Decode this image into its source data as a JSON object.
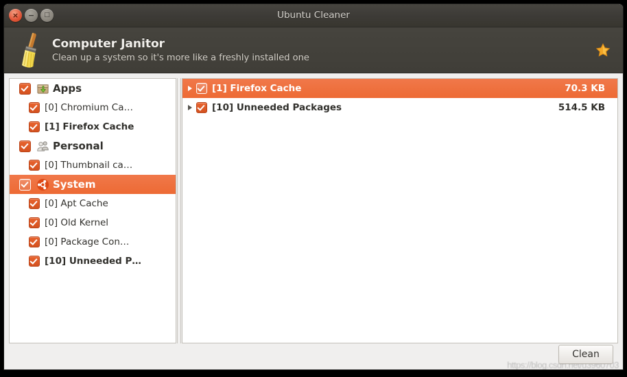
{
  "window": {
    "title": "Ubuntu Cleaner",
    "controls": [
      {
        "name": "close",
        "glyph": "×"
      },
      {
        "name": "minimize",
        "glyph": "−"
      },
      {
        "name": "maximize",
        "glyph": "□"
      }
    ]
  },
  "header": {
    "icon": "broom-icon",
    "title": "Computer Janitor",
    "subtitle": "Clean up a system so it's more like a freshly installed one",
    "favorite_icon": "star-icon"
  },
  "sidebar": {
    "items": [
      {
        "label": "Apps",
        "checked": true,
        "level": 0,
        "icon": "package-icon",
        "bold": true,
        "selected": false,
        "truncated": false
      },
      {
        "label": "[0] Chromium Ca…",
        "checked": true,
        "level": 1,
        "icon": "",
        "bold": false,
        "selected": false,
        "truncated": true
      },
      {
        "label": "[1] Firefox Cache",
        "checked": true,
        "level": 1,
        "icon": "",
        "bold": true,
        "selected": false,
        "truncated": false
      },
      {
        "label": "Personal",
        "checked": true,
        "level": 0,
        "icon": "people-icon",
        "bold": true,
        "selected": false,
        "truncated": false
      },
      {
        "label": "[0] Thumbnail ca…",
        "checked": true,
        "level": 1,
        "icon": "",
        "bold": false,
        "selected": false,
        "truncated": true
      },
      {
        "label": "System",
        "checked": true,
        "level": 0,
        "icon": "ubuntu-icon",
        "bold": true,
        "selected": true,
        "truncated": false
      },
      {
        "label": "[0] Apt Cache",
        "checked": true,
        "level": 1,
        "icon": "",
        "bold": false,
        "selected": false,
        "truncated": false
      },
      {
        "label": "[0] Old Kernel",
        "checked": true,
        "level": 1,
        "icon": "",
        "bold": false,
        "selected": false,
        "truncated": false
      },
      {
        "label": "[0] Package Con…",
        "checked": true,
        "level": 1,
        "icon": "",
        "bold": false,
        "selected": false,
        "truncated": true
      },
      {
        "label": "[10] Unneeded P…",
        "checked": true,
        "level": 1,
        "icon": "",
        "bold": true,
        "selected": false,
        "truncated": true
      }
    ]
  },
  "main": {
    "rows": [
      {
        "label": "[1] Firefox Cache",
        "size": "70.3 KB",
        "checked": true,
        "selected": true,
        "expandable": true
      },
      {
        "label": "[10] Unneeded Packages",
        "size": "514.5 KB",
        "checked": true,
        "selected": false,
        "expandable": true
      }
    ]
  },
  "footer": {
    "clean_label": "Clean",
    "watermark": "https://blog.csdn.net/u3960703"
  },
  "colors": {
    "accent": "#ed6a34",
    "titlebar": "#3d3b37",
    "header": "#403e38",
    "pane": "#ffffff",
    "chrome": "#f0efee",
    "text": "#31302c"
  }
}
